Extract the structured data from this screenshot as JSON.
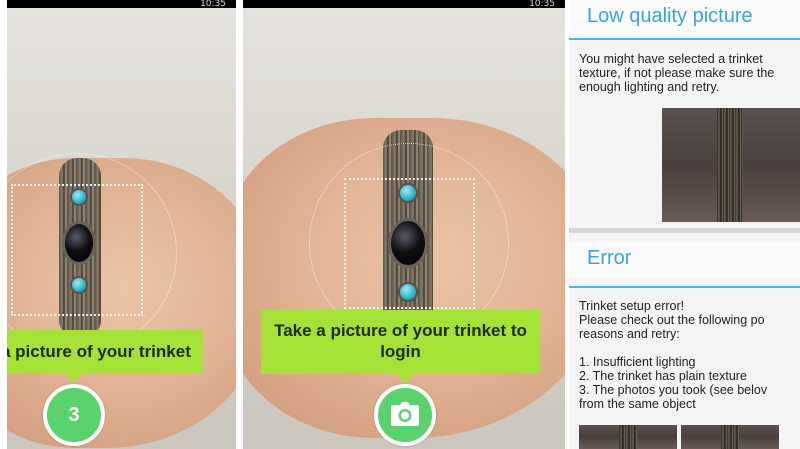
{
  "screens": [
    {
      "status_time": "10:35",
      "banner_text": "a picture of your trinket",
      "countdown_value": "3"
    },
    {
      "status_time": "10:35",
      "banner_text": "Take a picture of your trinket to login",
      "camera_button": "camera-icon"
    }
  ],
  "low_quality": {
    "title": "Low quality picture",
    "message": "You might have selected a trinket\ntexture, if not please make sure the\nenough  lighting and retry."
  },
  "error": {
    "title": "Error",
    "line1": "Trinket setup error!",
    "line2": "Please check out the following po\nreasons and retry:",
    "items": [
      "1. Insufficient lighting",
      "2. The trinket has plain texture",
      "3. The photos you took (see belov\nfrom the same object"
    ]
  },
  "colors": {
    "accent_green": "#a5e136",
    "button_green": "#5ad26e",
    "dialog_blue": "#38a5d6"
  }
}
